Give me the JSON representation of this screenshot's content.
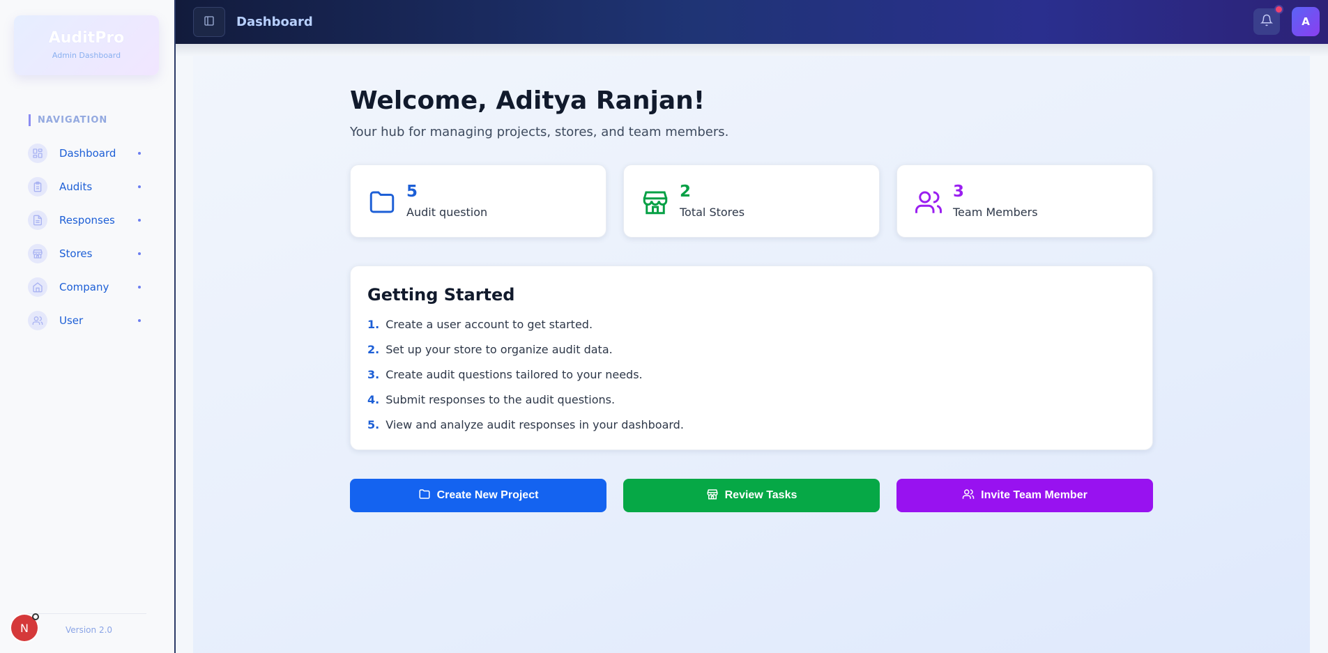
{
  "app": {
    "brand_name": "AuditPro",
    "brand_subtitle": "Admin Dashboard",
    "version": "Version 2.0",
    "floating_badge_letter": "N"
  },
  "sidebar": {
    "heading": "NAVIGATION",
    "items": [
      {
        "label": "Dashboard",
        "icon": "dashboard-icon"
      },
      {
        "label": "Audits",
        "icon": "clipboard-icon"
      },
      {
        "label": "Responses",
        "icon": "document-icon"
      },
      {
        "label": "Stores",
        "icon": "store-icon"
      },
      {
        "label": "Company",
        "icon": "home-icon"
      },
      {
        "label": "User",
        "icon": "users-icon"
      }
    ]
  },
  "header": {
    "title": "Dashboard",
    "avatar_initial": "A",
    "notification_icon": "bell-icon",
    "toggle_icon": "sidebar-toggle-icon"
  },
  "main": {
    "welcome": "Welcome, Aditya Ranjan!",
    "subtitle": "Your hub for managing projects, stores, and team members.",
    "stats": [
      {
        "value": "5",
        "label": "Audit question",
        "color": "#1d5fd6",
        "icon": "folder-icon"
      },
      {
        "value": "2",
        "label": "Total Stores",
        "color": "#06a045",
        "icon": "store-icon"
      },
      {
        "value": "3",
        "label": "Team Members",
        "color": "#9a1ff0",
        "icon": "users-icon"
      }
    ],
    "getting_started": {
      "title": "Getting Started",
      "steps": [
        {
          "num": "1.",
          "text": "Create a user account to get started."
        },
        {
          "num": "2.",
          "text": "Set up your store to organize audit data."
        },
        {
          "num": "3.",
          "text": "Create audit questions tailored to your needs."
        },
        {
          "num": "4.",
          "text": "Submit responses to the audit questions."
        },
        {
          "num": "5.",
          "text": "View and analyze audit responses in your dashboard."
        }
      ]
    },
    "actions": [
      {
        "label": "Create New Project",
        "color": "#1463f0",
        "icon": "folder-icon"
      },
      {
        "label": "Review Tasks",
        "color": "#06a846",
        "icon": "store-icon"
      },
      {
        "label": "Invite Team Member",
        "color": "#9812f0",
        "icon": "users-icon"
      }
    ]
  }
}
